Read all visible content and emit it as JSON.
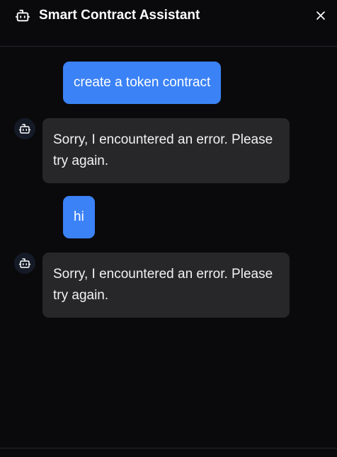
{
  "header": {
    "title": "Smart Contract Assistant",
    "icon": "bot-icon",
    "close_icon": "close-icon"
  },
  "messages": [
    {
      "role": "user",
      "text": "create a token contract"
    },
    {
      "role": "assistant",
      "text": "Sorry, I encountered an error. Please try again."
    },
    {
      "role": "user",
      "text": "hi"
    },
    {
      "role": "assistant",
      "text": "Sorry, I encountered an error. Please try again."
    }
  ],
  "colors": {
    "background": "#0a0a0c",
    "user_bubble": "#3b82f6",
    "bot_bubble": "#27272a",
    "divider": "#26262b"
  }
}
